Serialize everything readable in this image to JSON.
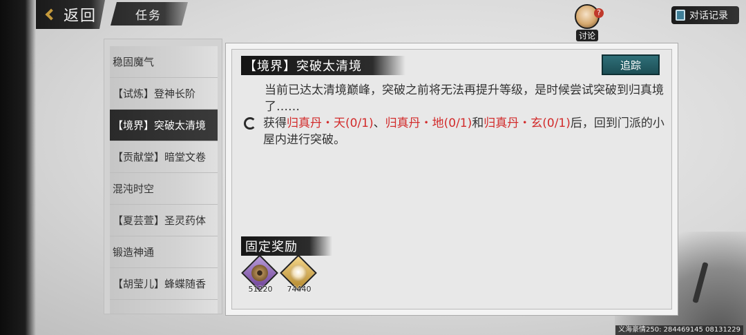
{
  "header": {
    "back_label": "返回",
    "title": "任务",
    "discuss_label": "讨论",
    "dialog_log_label": "对话记录"
  },
  "quest_list": [
    {
      "label": "稳固魔气",
      "active": false
    },
    {
      "label": "【试炼】登神长阶",
      "active": false
    },
    {
      "label": "【境界】突破太清境",
      "active": true
    },
    {
      "label": "【贡献堂】暗堂文卷",
      "active": false
    },
    {
      "label": "混沌时空",
      "active": false
    },
    {
      "label": "【夏芸萱】圣灵药体",
      "active": false
    },
    {
      "label": "锻造神通",
      "active": false
    },
    {
      "label": "【胡莹儿】蜂蝶随香",
      "active": false
    }
  ],
  "detail": {
    "title": "【境界】突破太清境",
    "track_label": "追踪",
    "description": "当前已达太清境巅峰，突破之前将无法再提升等级，是时候尝试突破到归真境了……",
    "objective": {
      "prefix": "获得",
      "item1": "归真丹・天",
      "item1_progress": "(0/1)",
      "sep1": "、",
      "item2": "归真丹・地",
      "item2_progress": "(0/1)",
      "sep2": "和",
      "item3": "归真丹・玄",
      "item3_progress": "(0/1)",
      "suffix": "后，回到门派的小屋内进行突破。"
    },
    "reward_title": "固定奖励",
    "rewards": [
      {
        "icon": "coin-icon",
        "count": "51220",
        "color": "#7b4fa3"
      },
      {
        "icon": "experience-icon",
        "count": "74440",
        "color": "#c89b35"
      }
    ]
  },
  "footer": {
    "text": "义海豪情250: 284469145  08131229"
  }
}
